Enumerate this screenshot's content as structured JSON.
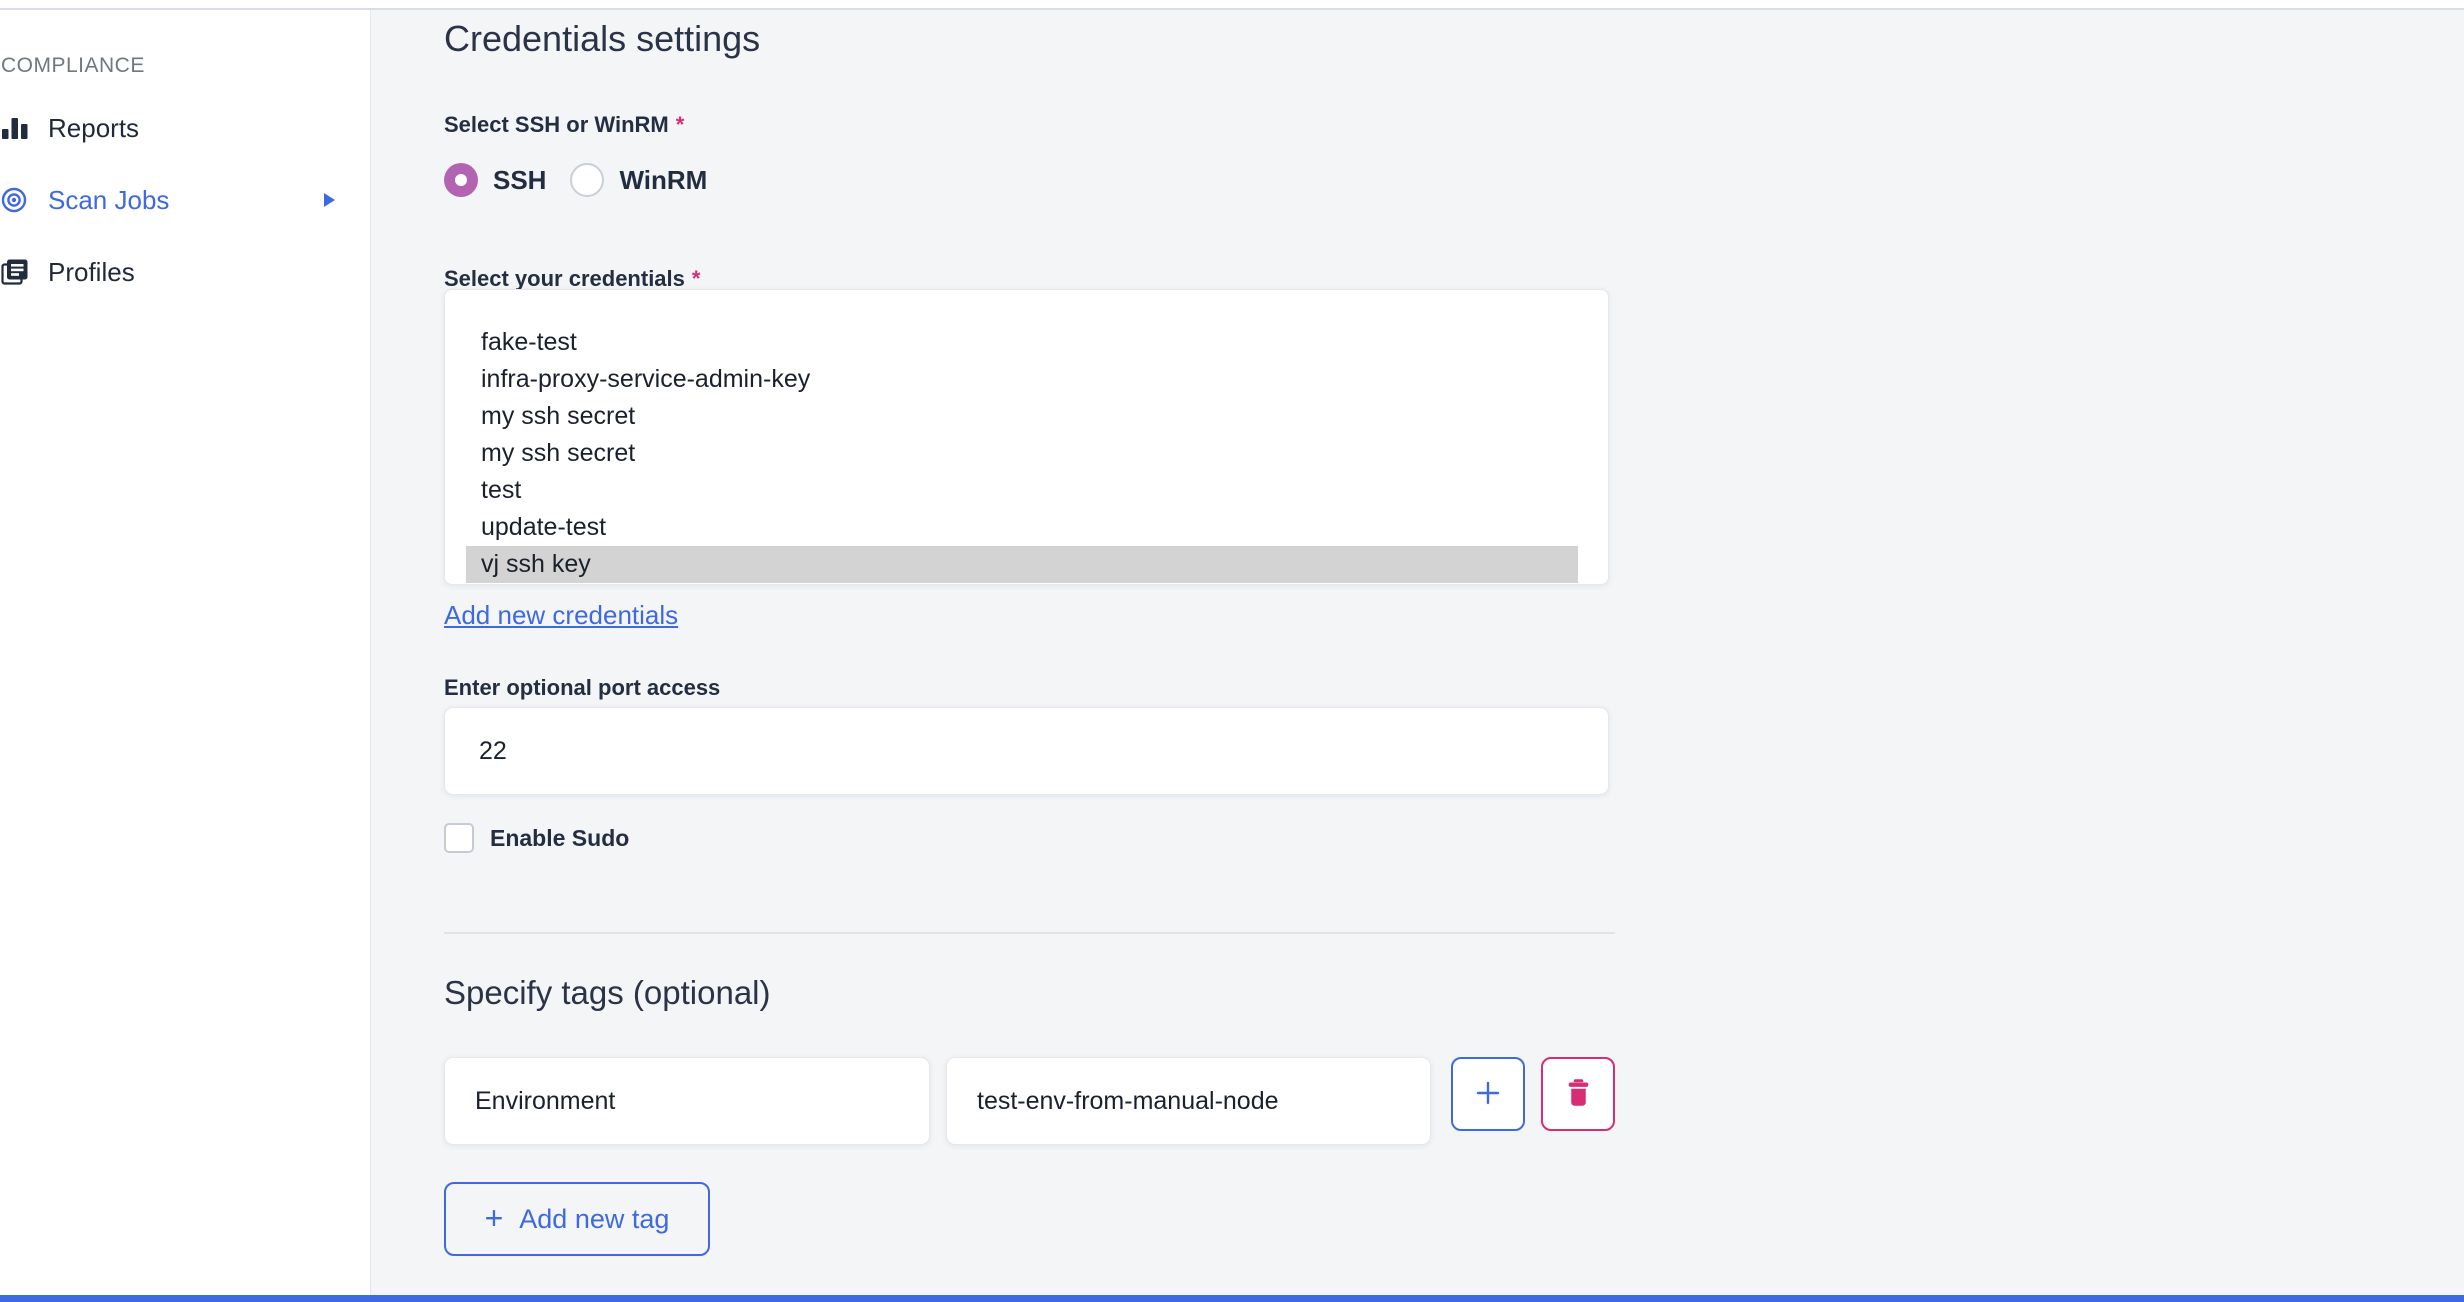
{
  "colors": {
    "accent_blue": "#3F69E0",
    "pink": "#D62D74",
    "radio_purple": "#B264B2",
    "dark_navy": "#2A3347",
    "content_background": "#F4F5F7",
    "selected_option_background": "#D3D3D3"
  },
  "sidebar": {
    "category": "COMPLIANCE",
    "items": [
      {
        "label": "Reports",
        "icon": "bar-chart-icon",
        "active": false
      },
      {
        "label": "Scan Jobs",
        "icon": "radar-icon",
        "active": true,
        "has_submenu_arrow": true
      },
      {
        "label": "Profiles",
        "icon": "documents-icon",
        "active": false
      }
    ]
  },
  "main": {
    "title": "Credentials settings",
    "protocol": {
      "label": "Select SSH or WinRM",
      "required_marker": "*",
      "options": [
        {
          "label": "SSH",
          "selected": true
        },
        {
          "label": "WinRM",
          "selected": false
        }
      ]
    },
    "credentials": {
      "label": "Select your credentials",
      "required_marker": "*",
      "options": [
        "fake-test",
        "infra-proxy-service-admin-key",
        "my ssh secret",
        "my ssh secret",
        "test",
        "update-test",
        "vj ssh key"
      ],
      "selected_option": "vj ssh key",
      "add_link_label": "Add new credentials"
    },
    "port": {
      "label": "Enter optional port access",
      "value": "22"
    },
    "sudo": {
      "label": "Enable Sudo",
      "checked": false
    },
    "tags": {
      "title": "Specify tags (optional)",
      "rows": [
        {
          "key": "Environment",
          "value": "test-env-from-manual-node"
        }
      ],
      "plus_symbol": "+",
      "add_button_label": "Add new tag"
    }
  }
}
